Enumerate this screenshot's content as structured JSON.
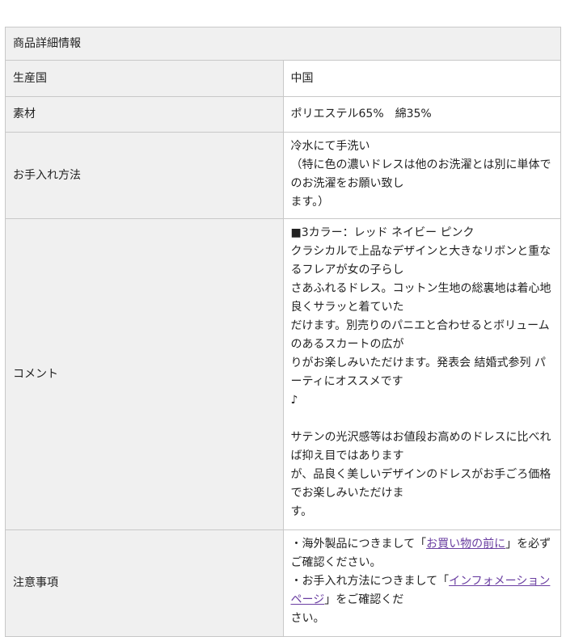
{
  "header": {
    "title": "商品詳細情報"
  },
  "rows": {
    "country": {
      "label": "生産国",
      "value": "中国"
    },
    "material": {
      "label": "素材",
      "value": "ポリエステル65%　綿35%"
    },
    "care": {
      "label": "お手入れ方法",
      "line1": "冷水にて手洗い",
      "line2": "（特に色の濃いドレスは他のお洗濯とは別に単体でのお洗濯をお願い致し",
      "line3": "ます。）"
    },
    "comment": {
      "label": "コメント",
      "lines": [
        "■3カラー：レッド ネイビー ピンク",
        "クラシカルで上品なデザインと大きなリボンと重なるフレアが女の子らし",
        "さあふれるドレス。コットン生地の総裏地は着心地良くサラッと着ていた",
        "だけます。別売りのパニエと合わせるとボリュームのあるスカートの広が",
        "りがお楽しみいただけます。発表会 結婚式参列 パーティにオススメです",
        "♪",
        "サテンの光沢感等はお値段お高めのドレスに比べれば抑え目ではあります",
        "が、品良く美しいデザインのドレスがお手ごろ価格でお楽しみいただけま",
        "す。"
      ]
    },
    "notes": {
      "label": "注意事項",
      "note1_prefix": "・海外製品につきまして「",
      "note1_link": "お買い物の前に",
      "note1_suffix": "」を必ずご確認ください。",
      "note2_prefix": "・お手入れ方法につきまして「",
      "note2_link": "インフォメーションページ",
      "note2_suffix": "」をご確認くだ",
      "note2_line2": "さい。"
    }
  },
  "colors": {
    "label_background": "#f0f0f0",
    "border": "#c8c8c8",
    "link": "#6a3ea1"
  }
}
